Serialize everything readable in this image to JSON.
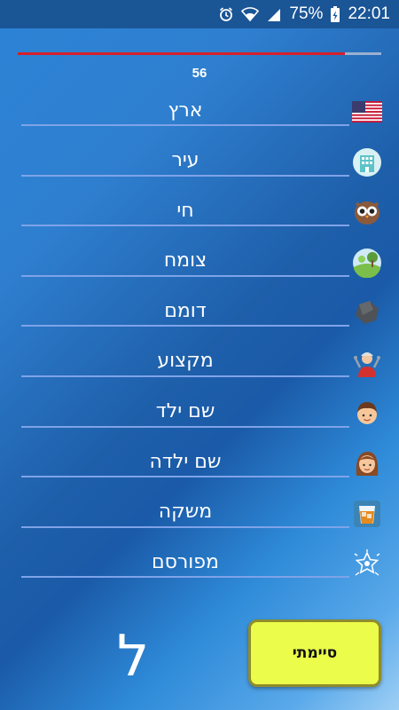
{
  "status_bar": {
    "battery": "75%",
    "time": "22:01",
    "icons": [
      "alarm-icon",
      "wifi-icon",
      "signal-icon",
      "battery-charging-icon"
    ]
  },
  "game": {
    "timer": "56",
    "time_progress": 0.9,
    "progress_color": "#d5202a",
    "letter": "ל",
    "done_label": "סיימתי"
  },
  "categories": [
    {
      "label": "ארץ",
      "icon": "us-flag-icon"
    },
    {
      "label": "עיר",
      "icon": "city-building-icon"
    },
    {
      "label": "חי",
      "icon": "owl-icon"
    },
    {
      "label": "צומח",
      "icon": "plant-landscape-icon"
    },
    {
      "label": "דומם",
      "icon": "rock-icon"
    },
    {
      "label": "מקצוע",
      "icon": "worker-icon"
    },
    {
      "label": "שם ילד",
      "icon": "boy-face-icon"
    },
    {
      "label": "שם ילדה",
      "icon": "girl-face-icon"
    },
    {
      "label": "משקה",
      "icon": "drink-glass-icon"
    },
    {
      "label": "מפורסם",
      "icon": "star-celebrity-icon"
    }
  ]
}
